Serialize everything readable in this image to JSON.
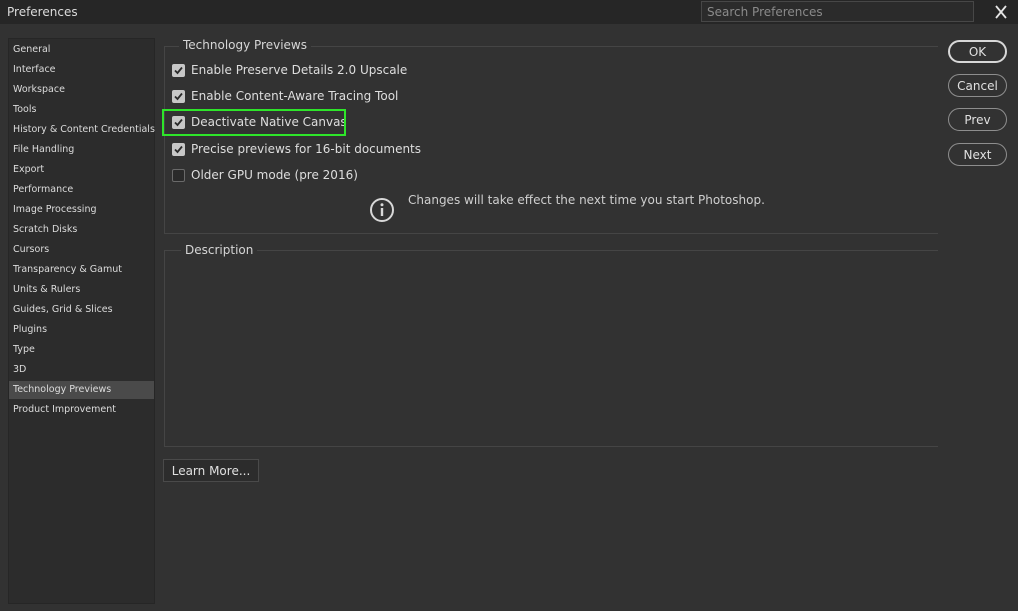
{
  "window": {
    "title": "Preferences",
    "search_placeholder": "Search Preferences"
  },
  "sidebar": {
    "items": [
      {
        "label": "General"
      },
      {
        "label": "Interface"
      },
      {
        "label": "Workspace"
      },
      {
        "label": "Tools"
      },
      {
        "label": "History & Content Credentials"
      },
      {
        "label": "File Handling"
      },
      {
        "label": "Export"
      },
      {
        "label": "Performance"
      },
      {
        "label": "Image Processing"
      },
      {
        "label": "Scratch Disks"
      },
      {
        "label": "Cursors"
      },
      {
        "label": "Transparency & Gamut"
      },
      {
        "label": "Units & Rulers"
      },
      {
        "label": "Guides, Grid & Slices"
      },
      {
        "label": "Plugins"
      },
      {
        "label": "Type"
      },
      {
        "label": "3D"
      },
      {
        "label": "Technology Previews"
      },
      {
        "label": "Product Improvement"
      }
    ],
    "selected": "Technology Previews"
  },
  "tech_previews": {
    "title": "Technology Previews",
    "options": [
      {
        "label": "Enable Preserve Details 2.0 Upscale",
        "checked": true
      },
      {
        "label": "Enable Content-Aware Tracing Tool",
        "checked": true
      },
      {
        "label": "Deactivate Native Canvas",
        "checked": true
      },
      {
        "label": "Precise previews for 16-bit documents",
        "checked": true
      },
      {
        "label": "Older GPU mode (pre 2016)",
        "checked": false
      }
    ],
    "info_text": "Changes will take effect the next time you start Photoshop."
  },
  "description": {
    "title": "Description"
  },
  "buttons": {
    "ok": "OK",
    "cancel": "Cancel",
    "prev": "Prev",
    "next": "Next",
    "learn_more": "Learn More..."
  },
  "colors": {
    "highlight": "#2ee52a",
    "background": "#323232"
  }
}
